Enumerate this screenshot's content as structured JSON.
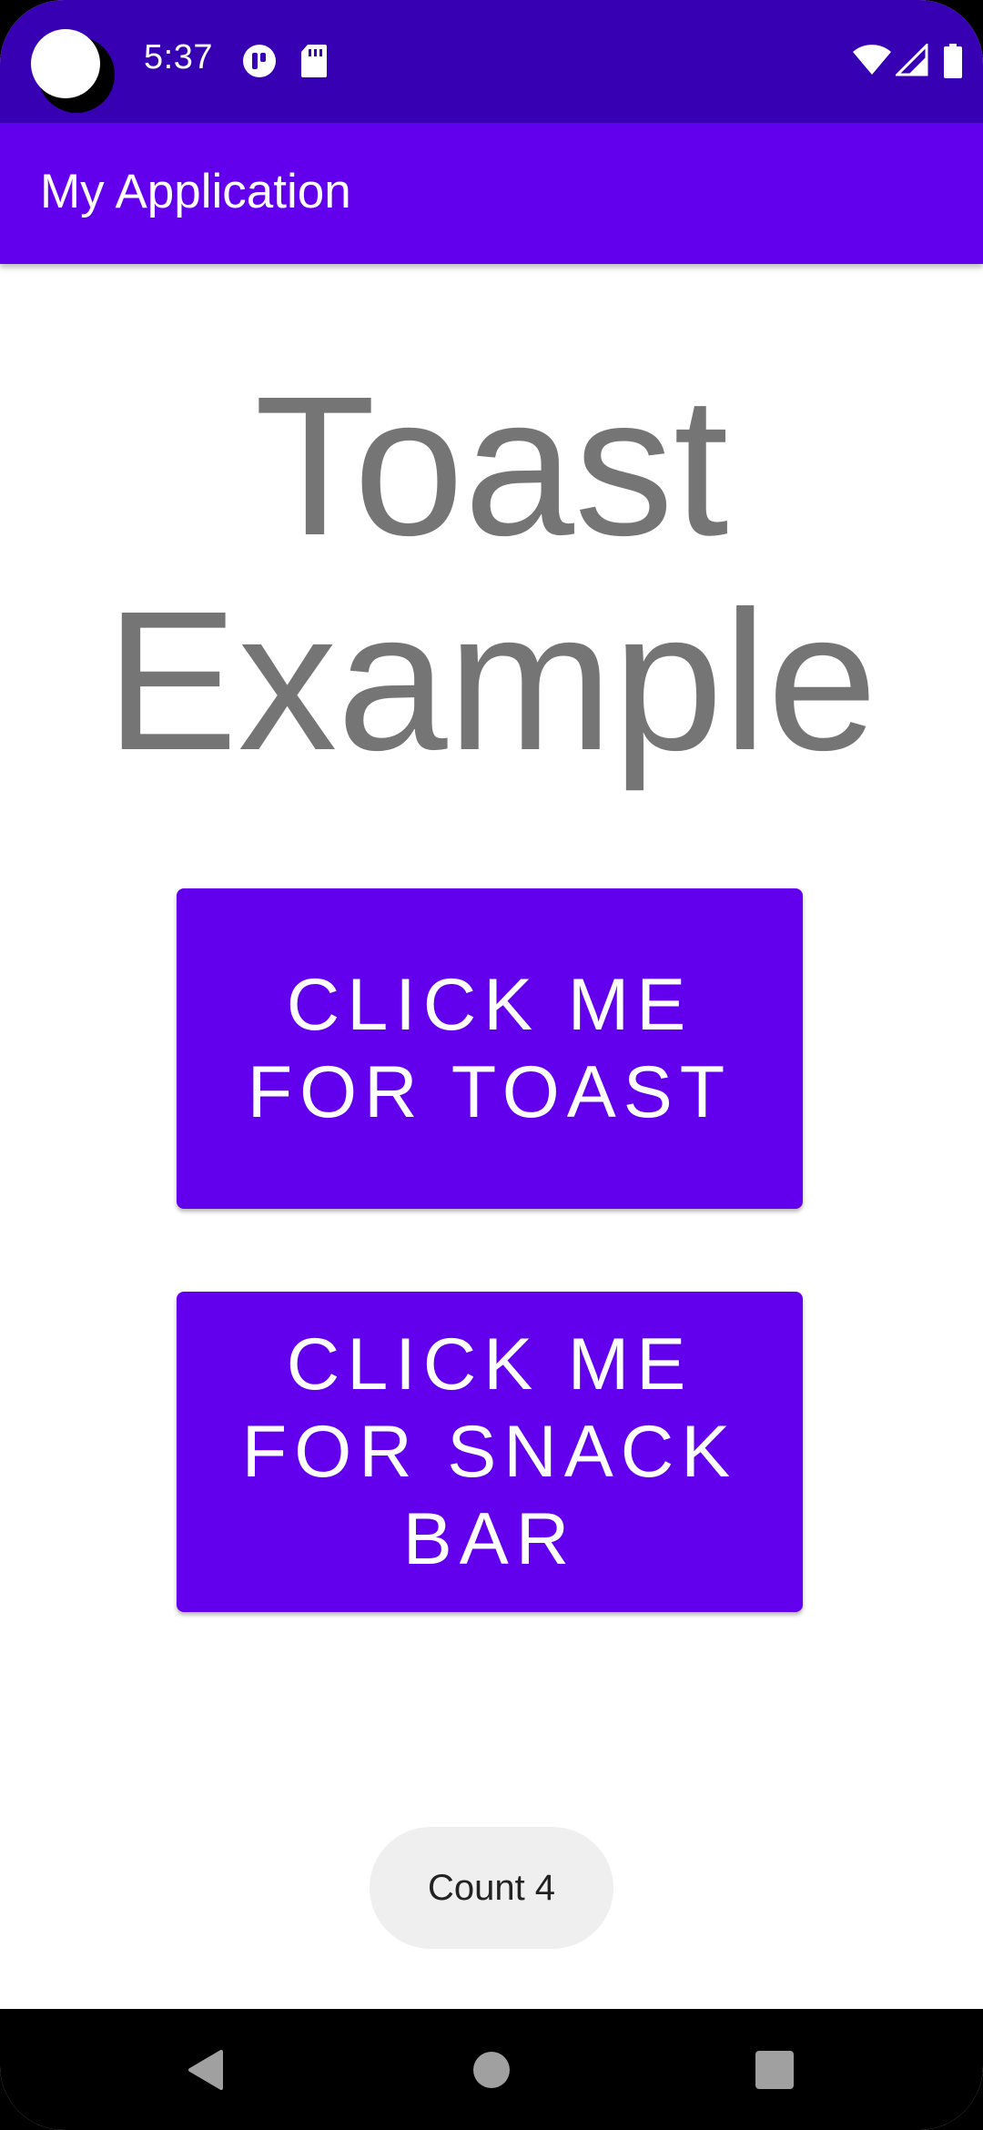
{
  "status_bar": {
    "time": "5:37",
    "icons": [
      "camera-cutout-icon",
      "app-notification-icon",
      "sd-card-icon",
      "wifi-icon",
      "signal-icon",
      "battery-icon"
    ],
    "color": "#3700b3"
  },
  "app_bar": {
    "title": "My Application",
    "color": "#6200ee"
  },
  "main": {
    "headline_line1": "Toast",
    "headline_line2": "Example",
    "toast_button": {
      "line1": "CLICK ME",
      "line2": "FOR TOAST"
    },
    "snackbar_button": {
      "line1": "CLICK ME",
      "line2": "FOR SNACK",
      "line3": "BAR"
    },
    "button_color": "#6200ee"
  },
  "toast": {
    "text": "Count 4"
  },
  "nav_bar": {
    "icons": [
      "back-icon",
      "home-icon",
      "recents-icon"
    ]
  }
}
